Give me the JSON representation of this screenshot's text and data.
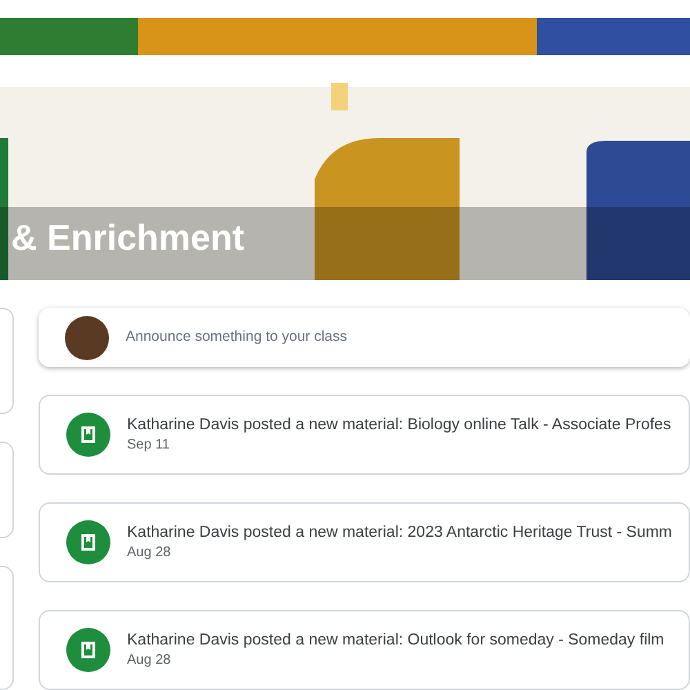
{
  "banner": {
    "title": "& Enrichment"
  },
  "announce": {
    "placeholder": "Announce something to your class"
  },
  "stream": [
    {
      "text": "Katharine Davis posted a new material: Biology online Talk - Associate Profes",
      "date": "Sep 11"
    },
    {
      "text": "Katharine Davis posted a new material: 2023 Antarctic Heritage Trust - Summ",
      "date": "Aug 28"
    },
    {
      "text": "Katharine Davis posted a new material: Outlook for someday - Someday film",
      "date": "Aug 28"
    }
  ]
}
